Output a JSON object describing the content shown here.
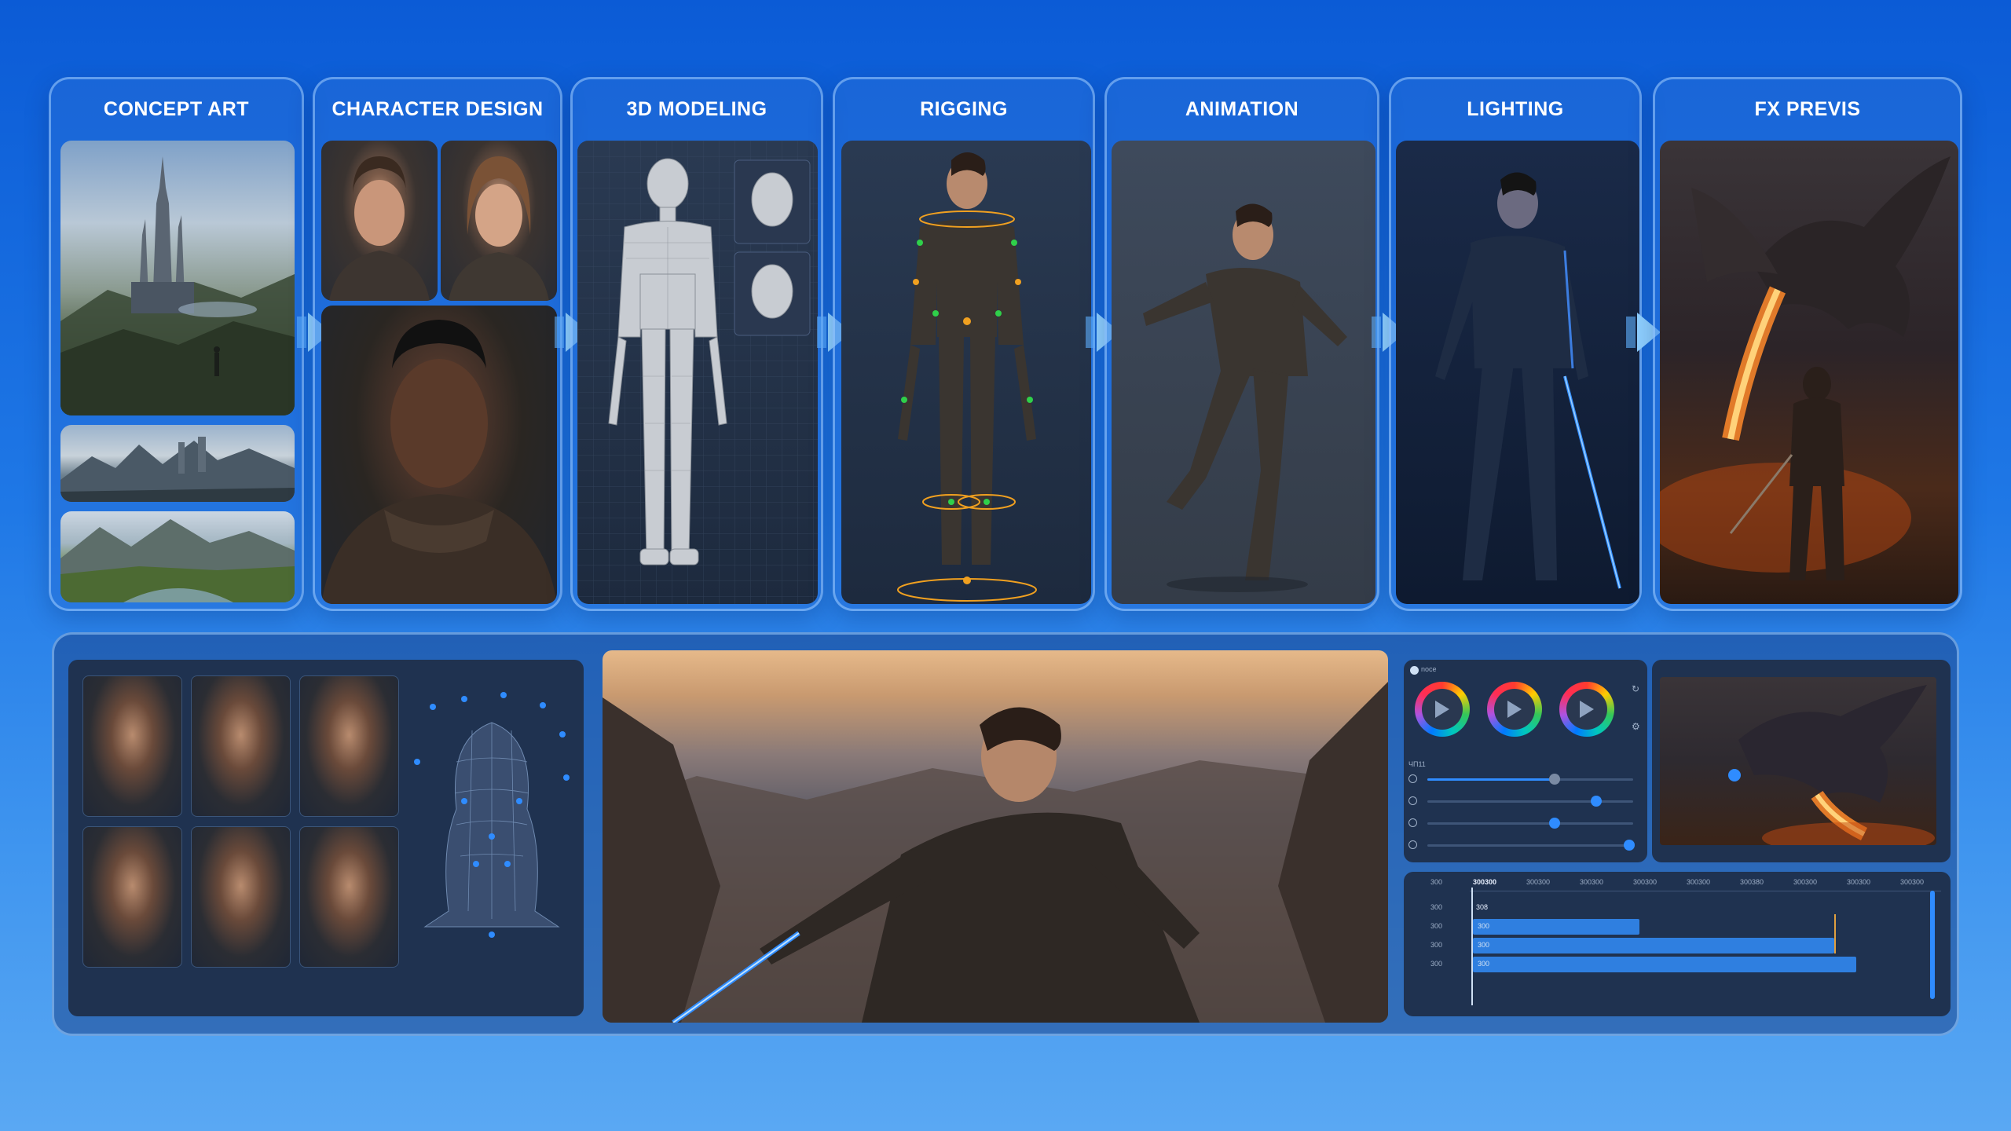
{
  "stages": [
    {
      "id": "concept-art",
      "title": "CONCEPT ART"
    },
    {
      "id": "character-design",
      "title": "CHARACTER DESIGN"
    },
    {
      "id": "3d-modeling",
      "title": "3D MODELING"
    },
    {
      "id": "rigging",
      "title": "RIGGING"
    },
    {
      "id": "animation",
      "title": "ANIMATION"
    },
    {
      "id": "lighting",
      "title": "LIGHTING"
    },
    {
      "id": "fx-previs",
      "title": "FX PREVIS"
    }
  ],
  "grading": {
    "header": "noce",
    "section_label": "ЧП11",
    "sliders": [
      0.62,
      0.82,
      0.62,
      0.98
    ]
  },
  "timeline": {
    "ruler": [
      "300300",
      "300300",
      "300300",
      "300300",
      "300300",
      "300380",
      "300300",
      "300300",
      "300300"
    ],
    "tracks": [
      {
        "label": "300",
        "clip": "308"
      },
      {
        "label": "300",
        "clip": "300"
      },
      {
        "label": "300",
        "clip": "300"
      },
      {
        "label": "300",
        "clip": "300"
      }
    ],
    "top_label": "300"
  },
  "colors": {
    "accent": "#2f8cff",
    "background_top": "#0b5bd6",
    "background_bottom": "#5aa8f3"
  }
}
